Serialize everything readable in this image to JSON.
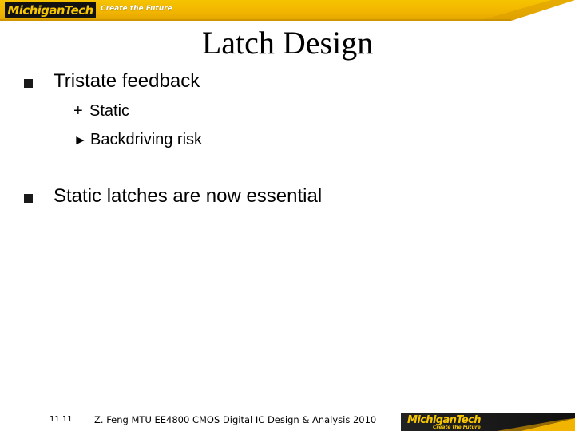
{
  "header": {
    "logo_text": "MichiganTech",
    "tagline": "Create the Future"
  },
  "slide": {
    "title": "Latch Design",
    "bullets": [
      {
        "text": "Tristate feedback",
        "sub": [
          {
            "marker": "+",
            "text": "Static"
          },
          {
            "marker": "►",
            "text": "Backdriving risk"
          }
        ]
      },
      {
        "text": "Static latches are now essential",
        "sub": []
      }
    ]
  },
  "footer": {
    "slide_number": "11.11",
    "text": "Z. Feng MTU EE4800 CMOS Digital IC Design & Analysis 2010",
    "logo_text": "MichiganTech",
    "logo_tagline": "Create the Future"
  },
  "colors": {
    "brand_gold": "#f1b400",
    "brand_black": "#111111"
  },
  "icons": {
    "bullet": "square-bullet-icon",
    "sub_plus": "plus-marker-icon",
    "sub_arrow": "right-triangle-arrow-icon"
  }
}
